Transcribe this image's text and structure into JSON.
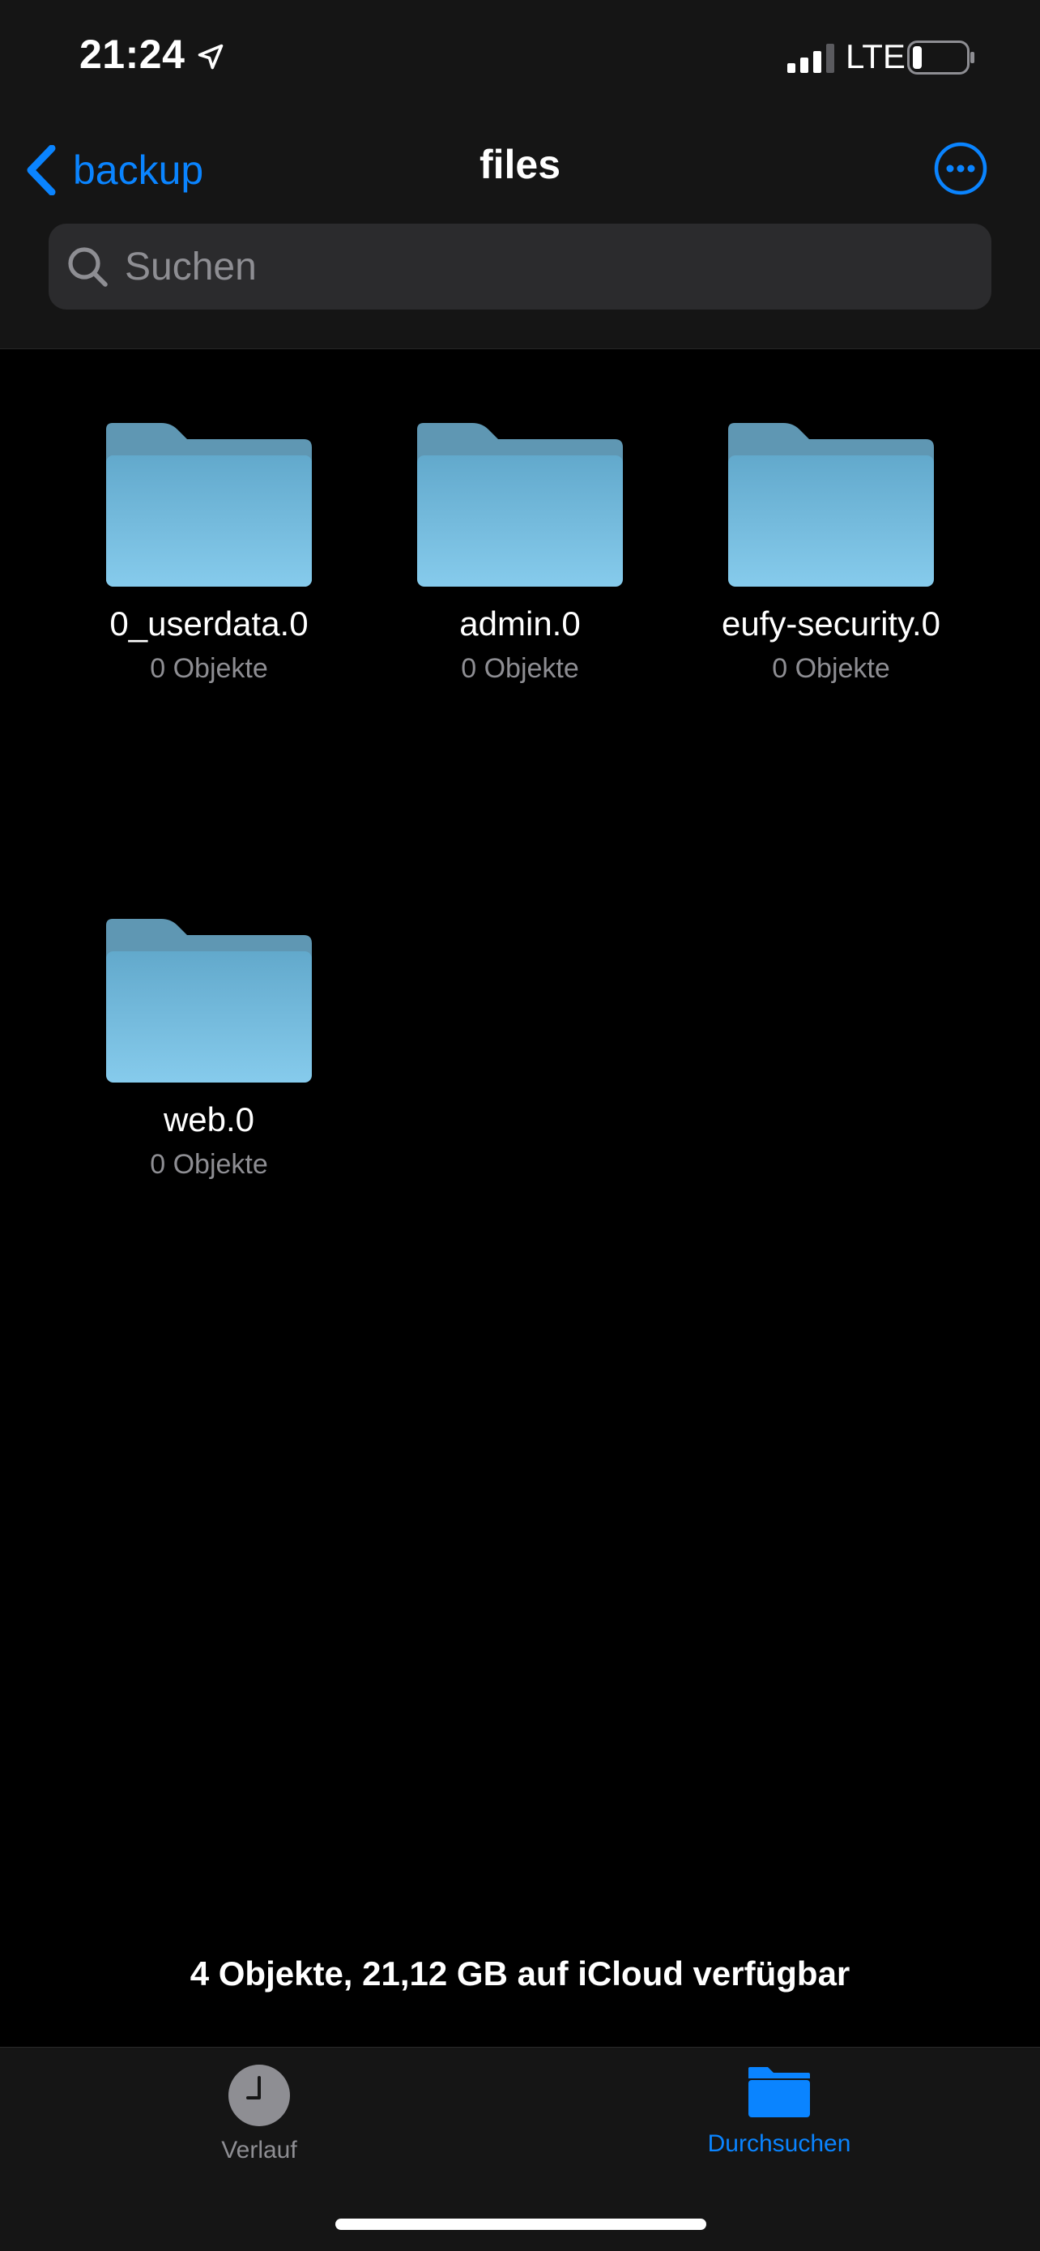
{
  "status_bar": {
    "time": "21:24",
    "network": "LTE"
  },
  "nav": {
    "back_label": "backup",
    "title": "files"
  },
  "search": {
    "placeholder": "Suchen"
  },
  "folders": [
    {
      "name": "0_userdata.0",
      "count": "0 Objekte"
    },
    {
      "name": "admin.0",
      "count": "0 Objekte"
    },
    {
      "name": "eufy-security.0",
      "count": "0 Objekte"
    },
    {
      "name": "web.0",
      "count": "0 Objekte"
    }
  ],
  "summary": "4 Objekte, 21,12 GB auf iCloud verfügbar",
  "tabs": {
    "recents": "Verlauf",
    "browse": "Durchsuchen"
  },
  "colors": {
    "accent": "#0a84ff",
    "folder_front": "#6db9dc",
    "folder_back": "#5f97b3"
  }
}
